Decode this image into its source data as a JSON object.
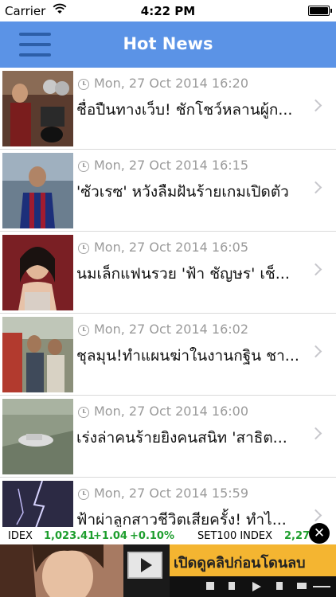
{
  "status": {
    "carrier": "Carrier",
    "time": "4:22 PM"
  },
  "nav": {
    "title": "Hot News"
  },
  "news": [
    {
      "date": "Mon, 27 Oct 2014 16:20",
      "headline": "ชื่อปืนทางเว็บ! ชักโชว์หลานผู้ก..."
    },
    {
      "date": "Mon, 27 Oct 2014 16:15",
      "headline": "'ซัวเรซ' หวังลืมฝันร้ายเกมเปิดตัว"
    },
    {
      "date": "Mon, 27 Oct 2014 16:05",
      "headline": "นมเล็กแฟนรวย 'ฟ้า ชัญษร' เช็..."
    },
    {
      "date": "Mon, 27 Oct 2014 16:02",
      "headline": "ชุลมุน!ทำแผนฆ่าในงานกฐิน ชา..."
    },
    {
      "date": "Mon, 27 Oct 2014 16:00",
      "headline": "เร่งล่าคนร้ายยิงคนสนิท 'สาธิต..."
    },
    {
      "date": "Mon, 27 Oct 2014 15:59",
      "headline": "ฟ้าผ่าลูกสาวชีวิตเสียครั้ง! ทำไ..."
    }
  ],
  "ticker": {
    "index_label": "IDEX",
    "index_value": "1,023.41",
    "index_change": "+1.04",
    "index_pct": "+0.10%",
    "set100_label": "SET100 INDEX",
    "set100_value": "2,27",
    "colors": {
      "up": "#1e9e2e"
    }
  },
  "ad": {
    "text": "เปิดดูคลิปก่อนโดนลบ"
  },
  "icons": {
    "close": "✕"
  }
}
